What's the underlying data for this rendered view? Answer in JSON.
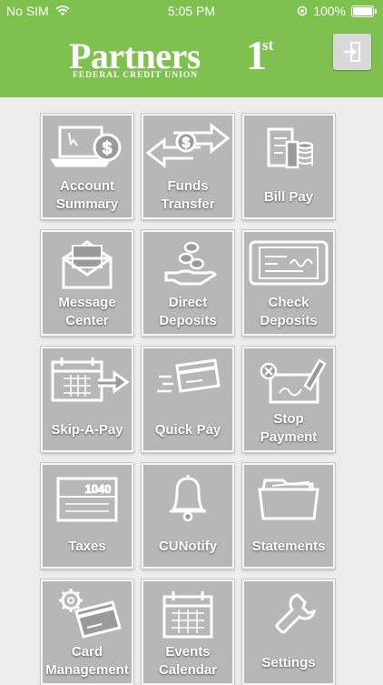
{
  "status_bar": {
    "carrier": "No SIM",
    "time": "5:05 PM",
    "battery": "100%"
  },
  "brand": {
    "name": "Partners",
    "first": "1",
    "first_suffix": "st",
    "tagline": "FEDERAL CREDIT UNION"
  },
  "menu": [
    {
      "label": [
        "Account",
        "Summary"
      ],
      "icon": "laptop-dollar-icon"
    },
    {
      "label": [
        "Funds",
        "Transfer"
      ],
      "icon": "transfer-arrows-icon"
    },
    {
      "label": [
        "Bill Pay"
      ],
      "icon": "bills-coins-icon"
    },
    {
      "label": [
        "Message",
        "Center"
      ],
      "icon": "envelope-icon"
    },
    {
      "label": [
        "Direct",
        "Deposits"
      ],
      "icon": "hand-coins-icon"
    },
    {
      "label": [
        "Check",
        "Deposits"
      ],
      "icon": "check-tablet-icon"
    },
    {
      "label": [
        "Skip-A-Pay"
      ],
      "icon": "calendar-arrow-icon"
    },
    {
      "label": [
        "Quick Pay"
      ],
      "icon": "card-swipe-icon"
    },
    {
      "label": [
        "Stop",
        "Payment"
      ],
      "icon": "stop-check-icon"
    },
    {
      "label": [
        "Taxes"
      ],
      "icon": "tax-form-icon"
    },
    {
      "label": [
        "CUNotify"
      ],
      "icon": "bell-icon"
    },
    {
      "label": [
        "Statements"
      ],
      "icon": "folder-icon"
    },
    {
      "label": [
        "Card",
        "Management"
      ],
      "icon": "card-gear-icon"
    },
    {
      "label": [
        "Events",
        "Calendar"
      ],
      "icon": "calendar-icon"
    },
    {
      "label": [
        "Settings"
      ],
      "icon": "wrench-icon"
    }
  ],
  "colors": {
    "header": "#7fc14f",
    "tile": "#b7b7b7",
    "background": "#ededed"
  }
}
